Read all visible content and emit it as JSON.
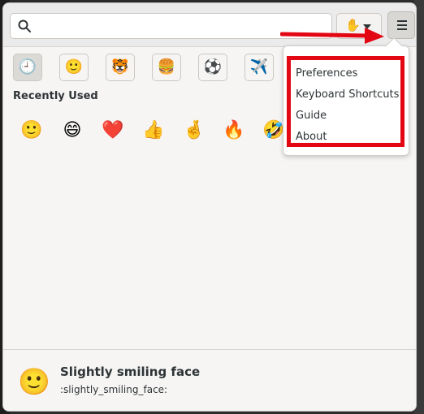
{
  "search": {
    "placeholder": "",
    "value": ""
  },
  "header": {
    "skin_tone_icon": "✋",
    "menu_icon": "hamburger-icon"
  },
  "categories": [
    {
      "name": "recent",
      "glyph": "🕘"
    },
    {
      "name": "smileys",
      "glyph": "🙂"
    },
    {
      "name": "animals",
      "glyph": "🐯"
    },
    {
      "name": "food",
      "glyph": "🍔"
    },
    {
      "name": "activities",
      "glyph": "⚽"
    },
    {
      "name": "travel",
      "glyph": "✈️"
    }
  ],
  "section": {
    "title": "Recently Used"
  },
  "recent": [
    "🙂",
    "😄",
    "❤️",
    "👍",
    "🤞",
    "🔥",
    "🤣"
  ],
  "menu": {
    "items": [
      "Preferences",
      "Keyboard Shortcuts",
      "Guide",
      "About"
    ]
  },
  "footer": {
    "emoji": "🙂",
    "name": "Slightly smiling face",
    "code": ":slightly_smiling_face:"
  },
  "colors": {
    "annotation": "#e30613",
    "accent_emoji": "#e9b21f"
  }
}
